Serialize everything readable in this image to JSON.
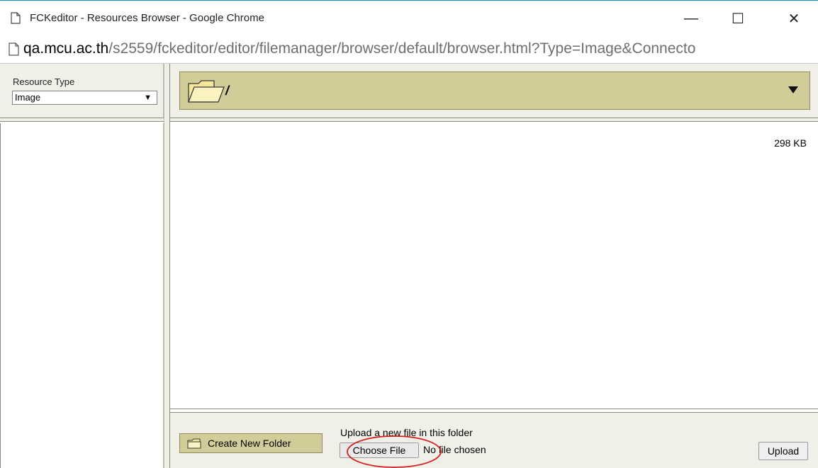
{
  "window": {
    "title": "FCKeditor - Resources Browser - Google Chrome",
    "minimize_glyph": "—",
    "maximize_glyph": "☐",
    "close_glyph": "✕"
  },
  "urlbar": {
    "host": "qa.mcu.ac.th",
    "path": "/s2559/fckeditor/editor/filemanager/browser/default/browser.html?Type=Image&Connecto"
  },
  "resource_type": {
    "label": "Resource Type",
    "selected": "Image",
    "arrow": "▼"
  },
  "folder_bar": {
    "current_path": "/"
  },
  "file_list": {
    "size_label": "298 KB"
  },
  "bottom": {
    "create_folder_label": "Create New Folder",
    "upload_hint": "Upload a new file in this folder",
    "choose_file_label": "Choose File",
    "no_file_label": "No file chosen",
    "upload_label": "Upload"
  },
  "colors": {
    "panel_bg": "#f0f0e8",
    "folder_bar_bg": "#d2cc98",
    "annotation": "#d42020"
  }
}
